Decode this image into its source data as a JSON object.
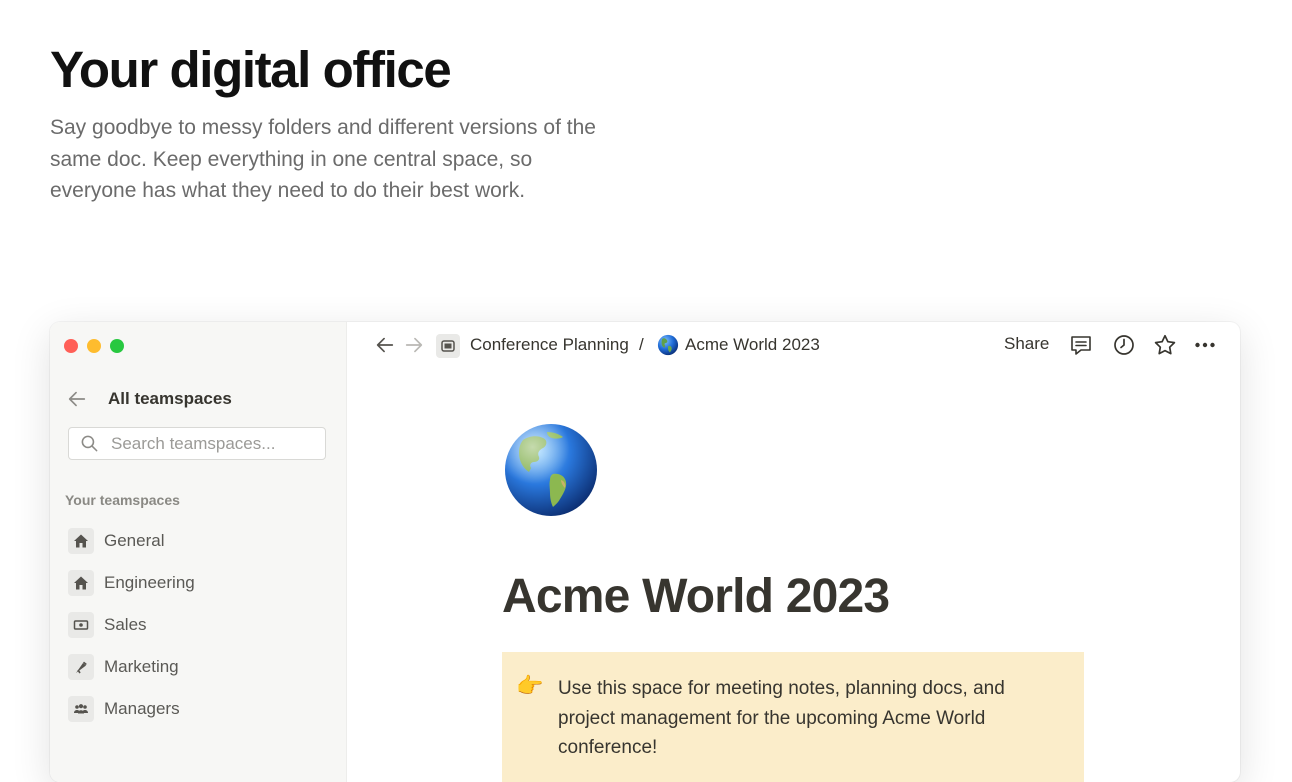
{
  "hero": {
    "title": "Your digital office",
    "description": "Say goodbye to messy folders and different versions of the same doc. Keep everything in one central space, so everyone has what they need to do their best work."
  },
  "sidebar": {
    "back_label": "All teamspaces",
    "search_placeholder": "Search teamspaces...",
    "section_label": "Your teamspaces",
    "teamspaces": [
      {
        "label": "General",
        "icon": "home-icon"
      },
      {
        "label": "Engineering",
        "icon": "home-icon"
      },
      {
        "label": "Sales",
        "icon": "cash-icon"
      },
      {
        "label": "Marketing",
        "icon": "megaphone-icon"
      },
      {
        "label": "Managers",
        "icon": "people-icon"
      }
    ]
  },
  "topbar": {
    "breadcrumb_parent": "Conference Planning",
    "breadcrumb_separator": "/",
    "breadcrumb_current": "Acme World 2023",
    "share_label": "Share"
  },
  "page": {
    "title": "Acme World 2023",
    "callout_icon": "👉",
    "callout_text": "Use this space for meeting notes, planning docs, and project management for the upcoming Acme World conference!"
  },
  "colors": {
    "callout_bg": "#fbedca",
    "sidebar_bg": "#f7f7f5",
    "traffic_red": "#ff5f57",
    "traffic_yellow": "#febc2e",
    "traffic_green": "#28c840"
  }
}
